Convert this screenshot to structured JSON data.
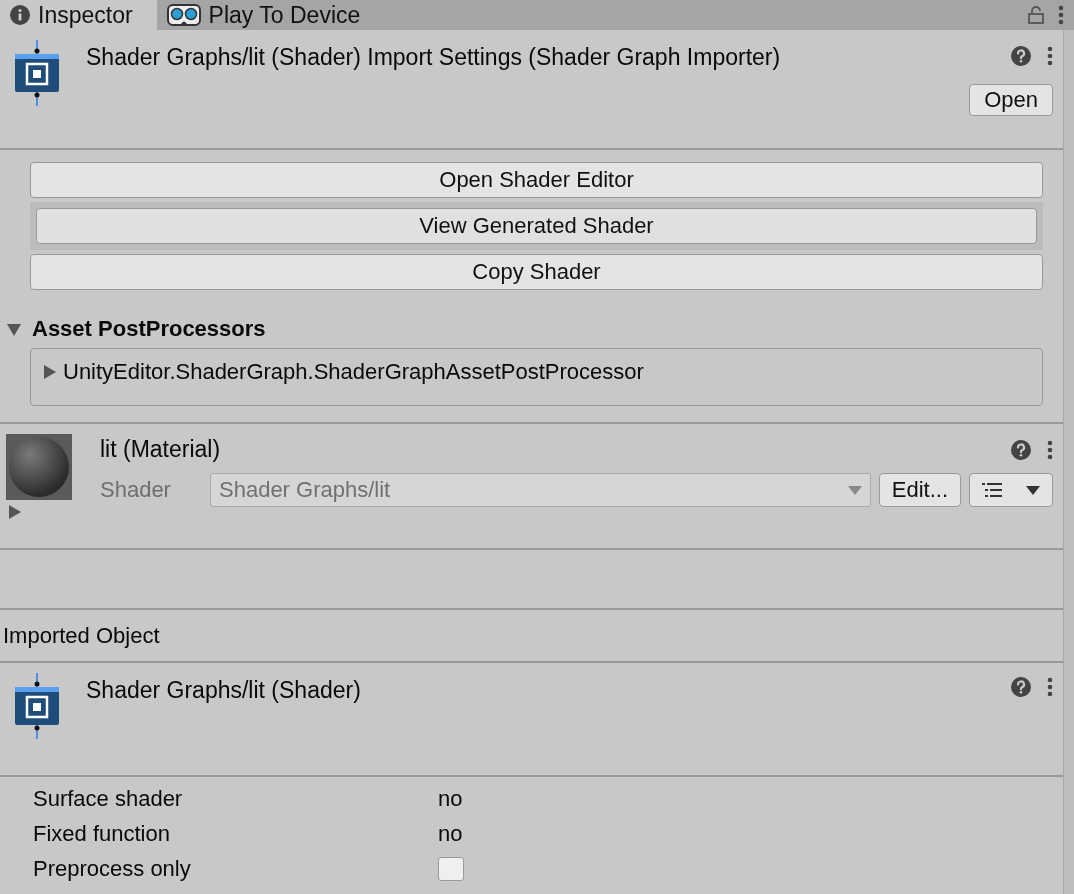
{
  "tabs": [
    {
      "label": "Inspector",
      "selected": true
    },
    {
      "label": "Play To Device",
      "selected": false
    }
  ],
  "importer": {
    "title": "Shader Graphs/lit (Shader) Import Settings (Shader Graph Importer)",
    "open_button": "Open"
  },
  "buttons": [
    {
      "label": "Open Shader Editor",
      "selected": false
    },
    {
      "label": "View Generated Shader",
      "selected": true
    },
    {
      "label": "Copy Shader",
      "selected": false
    }
  ],
  "post_processors": {
    "label": "Asset PostProcessors",
    "expanded": true,
    "items": [
      {
        "label": "UnityEditor.ShaderGraph.ShaderGraphAssetPostProcessor",
        "expanded": false
      }
    ]
  },
  "material": {
    "title": "lit (Material)",
    "shader_label": "Shader",
    "shader_value": "Shader Graphs/lit",
    "disabled": true,
    "edit_button": "Edit...",
    "expanded": false
  },
  "imported_object": {
    "label": "Imported Object",
    "title": "Shader Graphs/lit (Shader)"
  },
  "properties": [
    {
      "kind": "text",
      "label": "Surface shader",
      "value": "no"
    },
    {
      "kind": "text",
      "label": "Fixed function",
      "value": "no"
    },
    {
      "kind": "checkbox",
      "label": "Preprocess only",
      "checked": false
    }
  ]
}
